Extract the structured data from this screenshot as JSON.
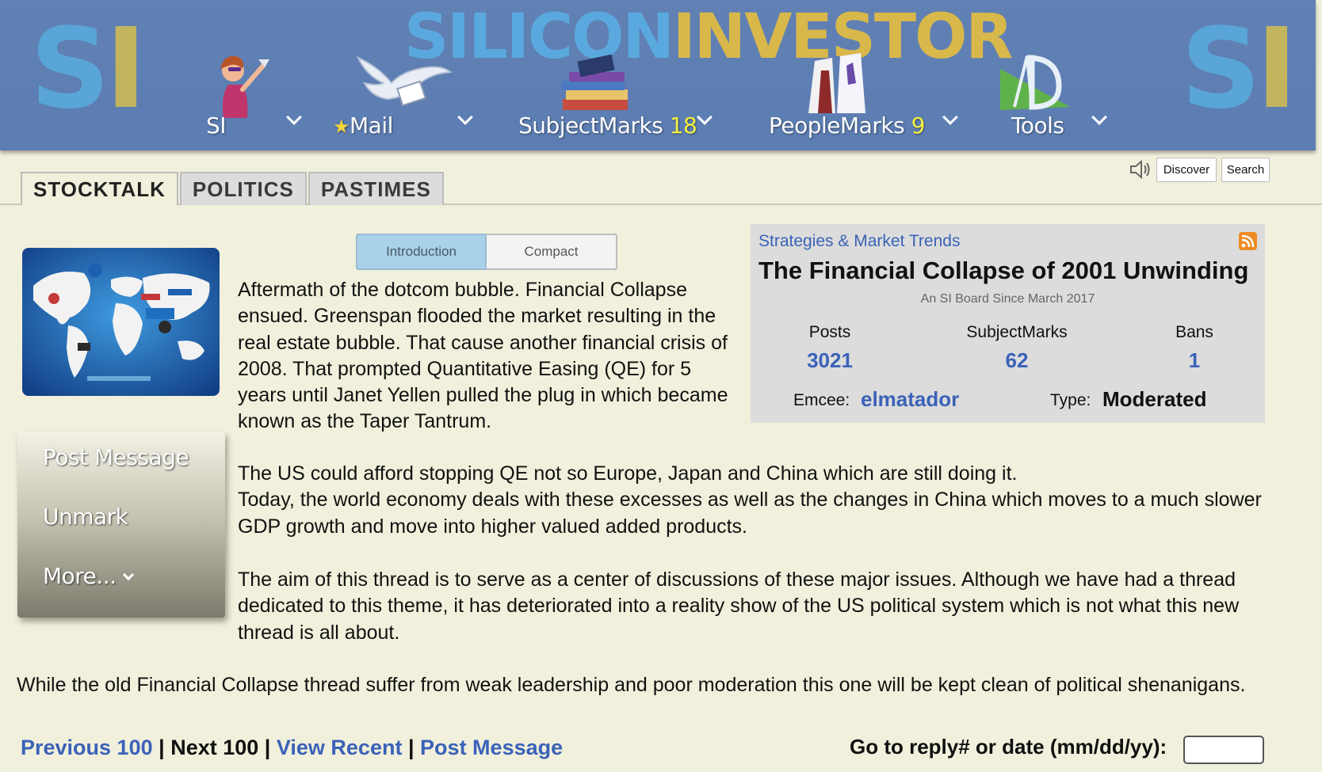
{
  "header": {
    "logo_left": {
      "s": "S",
      "i": "I"
    },
    "logo_right": {
      "s": "S",
      "i": "I"
    },
    "brand": {
      "part1": "SILICON",
      "part2": "INVESTOR"
    },
    "nav": {
      "si": {
        "label": "SI"
      },
      "mail": {
        "star": "★",
        "label": "Mail"
      },
      "subjectmarks": {
        "label": "SubjectMarks",
        "count": "18"
      },
      "peoplemarks": {
        "label": "PeopleMarks",
        "count": "9"
      },
      "tools": {
        "label": "Tools"
      }
    },
    "colors": {
      "banner": "#6181b4",
      "brand_blue": "#5aa9de",
      "brand_gold": "#d8b84a",
      "count_yellow": "#f4f040"
    }
  },
  "tabs": [
    {
      "label": "STOCKTALK",
      "active": true
    },
    {
      "label": "POLITICS",
      "active": false
    },
    {
      "label": "PASTIMES",
      "active": false
    }
  ],
  "toolbar": {
    "discover_label": "Discover",
    "search_label": "Search",
    "speaker_icon": "speaker-icon"
  },
  "view_toggle": {
    "introduction": "Introduction",
    "compact": "Compact",
    "selected": "Introduction"
  },
  "left_menu": {
    "post_message": "Post Message",
    "unmark": "Unmark",
    "more": "More..."
  },
  "intro": {
    "p1": "Aftermath of the dotcom bubble. Financial Collapse ensued. Greenspan flooded the market resulting in the real estate bubble. That cause another financial crisis of 2008. That prompted Quantitative Easing (QE) for 5 years until Janet Yellen pulled the plug in which became known as the Taper Tantrum.",
    "p2_line1": "The US could afford stopping QE not so Europe, Japan and China which are still doing it.",
    "p2_line2": "Today, the world economy deals with these excesses as well as the changes in China which moves to a much slower GDP growth and move into higher valued added products.",
    "p3": "The aim of this thread is to serve as a center of discussions of these major issues. Although we have had a thread dedicated to this theme, it has deteriorated into a reality show of the US political system which is not what this new thread is all about.",
    "p4": "While the old Financial Collapse thread suffer from weak leadership and poor moderation this one will be kept clean of political shenanigans."
  },
  "board_info": {
    "category": "Strategies & Market Trends",
    "title": "The Financial Collapse of 2001 Unwinding",
    "since": "An SI Board Since March 2017",
    "posts_label": "Posts",
    "posts_value": "3021",
    "subjectmarks_label": "SubjectMarks",
    "subjectmarks_value": "62",
    "bans_label": "Bans",
    "bans_value": "1",
    "emcee_label": "Emcee:",
    "emcee_value": "elmatador",
    "type_label": "Type:",
    "type_value": "Moderated",
    "link_color": "#3a62b8"
  },
  "footer_nav": {
    "previous": "Previous 100",
    "sep": "|",
    "next": "Next 100",
    "view_recent": "View Recent",
    "post_message": "Post Message",
    "goto_label": "Go to reply# or date (mm/dd/yy):",
    "goto_value": ""
  }
}
